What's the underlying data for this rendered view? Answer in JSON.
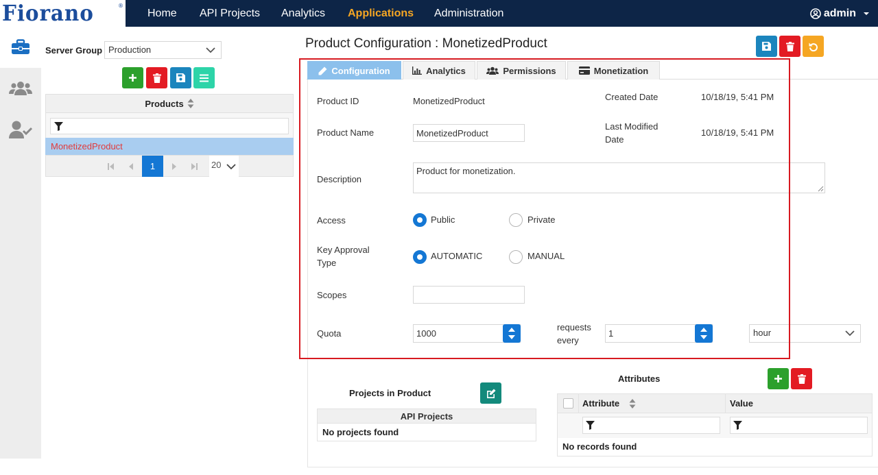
{
  "header": {
    "logo_text": "Fiorano",
    "logo_mark": "®",
    "nav": [
      {
        "label": "Home"
      },
      {
        "label": "API Projects"
      },
      {
        "label": "Analytics"
      },
      {
        "label": "Applications"
      },
      {
        "label": "Administration"
      }
    ],
    "active_nav": "Applications",
    "user": "admin"
  },
  "sidebar": {
    "items": [
      {
        "icon": "briefcase-icon",
        "active": true
      },
      {
        "icon": "users-icon",
        "active": false
      },
      {
        "icon": "user-check-icon",
        "active": false
      }
    ]
  },
  "products_panel": {
    "server_group_label": "Server Group",
    "server_group_value": "Production",
    "grid_header": "Products",
    "rows": [
      "MonetizedProduct"
    ],
    "page": "1",
    "page_size": "20"
  },
  "page_title": "Product Configuration : MonetizedProduct",
  "tabs": [
    {
      "label": "Configuration",
      "icon": "pencil-icon"
    },
    {
      "label": "Analytics",
      "icon": "bar-chart-icon"
    },
    {
      "label": "Permissions",
      "icon": "users-icon"
    },
    {
      "label": "Monetization",
      "icon": "credit-card-icon"
    }
  ],
  "form": {
    "product_id_label": "Product ID",
    "product_id_value": "MonetizedProduct",
    "created_date_label": "Created Date",
    "created_date_value": "10/18/19, 5:41 PM",
    "product_name_label": "Product Name",
    "product_name_value": "MonetizedProduct",
    "last_modified_label": "Last Modified Date",
    "last_modified_value": "10/18/19, 5:41 PM",
    "description_label": "Description",
    "description_value": "Product for monetization.",
    "access_label": "Access",
    "access_options": [
      "Public",
      "Private"
    ],
    "access_selected": "Public",
    "key_approval_label": "Key Approval Type",
    "key_approval_options": [
      "AUTOMATIC",
      "MANUAL"
    ],
    "key_approval_selected": "AUTOMATIC",
    "scopes_label": "Scopes",
    "scopes_value": "",
    "quota_label": "Quota",
    "quota_value": "1000",
    "requests_every_label": "requests every",
    "interval_value": "1",
    "unit_value": "hour"
  },
  "projects": {
    "title": "Projects in Product",
    "column": "API Projects",
    "empty": "No projects found"
  },
  "attributes": {
    "title": "Attributes",
    "col_attribute": "Attribute",
    "col_value": "Value",
    "empty": "No records found"
  },
  "colors": {
    "navbar": "#0d2547",
    "active_nav": "#f5a623",
    "accent_blue": "#1477d4",
    "highlight_red": "#d71920"
  }
}
